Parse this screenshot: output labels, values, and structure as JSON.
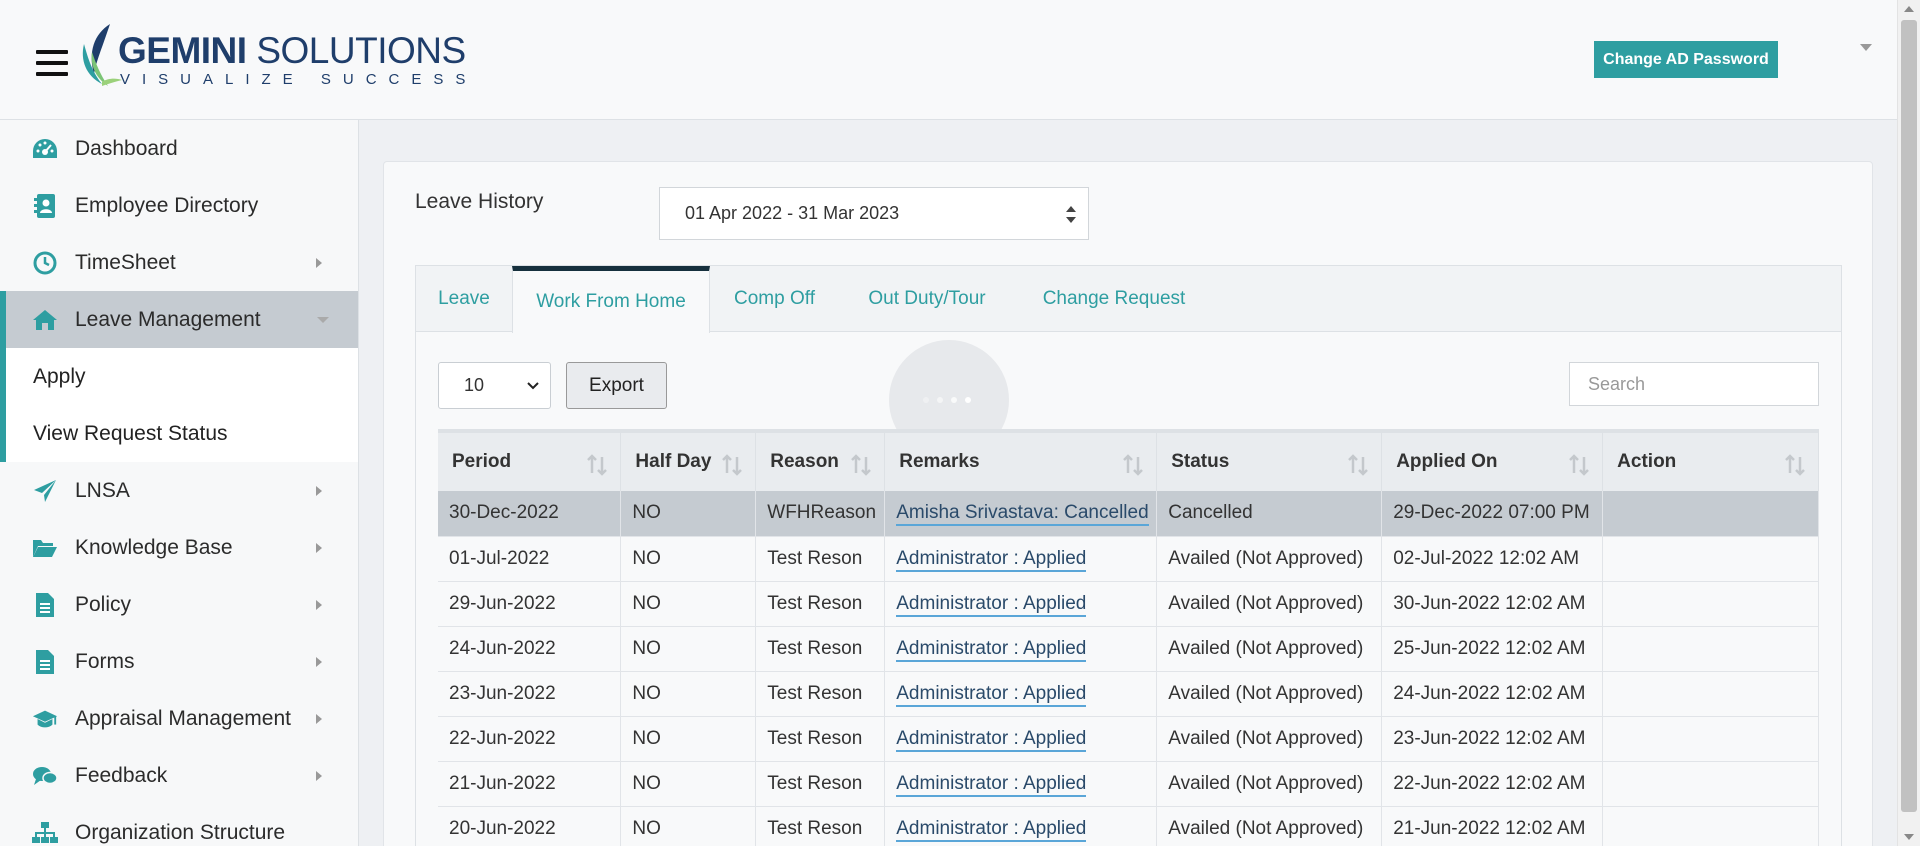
{
  "header": {
    "logo_name_bold": "GEMINI",
    "logo_name_rest": " SOLUTIONS",
    "logo_tagline": "VISUALIZE SUCCESS",
    "change_password_label": "Change AD Password"
  },
  "colors": {
    "accent": "#2e9ea1",
    "dark_tab": "#16303d",
    "link_underline": "#5aa6d8"
  },
  "sidebar": {
    "items": [
      {
        "label": "Dashboard",
        "icon": "dashboard-gauge-icon"
      },
      {
        "label": "Employee Directory",
        "icon": "contacts-book-icon"
      },
      {
        "label": "TimeSheet",
        "icon": "clock-icon"
      },
      {
        "label": "Leave Management",
        "icon": "home-icon"
      },
      {
        "label": "LNSA",
        "icon": "paper-plane-icon"
      },
      {
        "label": "Knowledge Base",
        "icon": "folder-open-icon"
      },
      {
        "label": "Policy",
        "icon": "document-icon"
      },
      {
        "label": "Forms",
        "icon": "document-icon"
      },
      {
        "label": "Appraisal Management",
        "icon": "graduation-cap-icon"
      },
      {
        "label": "Feedback",
        "icon": "chat-bubbles-icon"
      },
      {
        "label": "Organization Structure",
        "icon": "org-chart-icon"
      }
    ],
    "subitems": [
      {
        "label": "Apply"
      },
      {
        "label": "View Request Status"
      }
    ]
  },
  "main": {
    "title": "Leave History",
    "period": "01 Apr 2022 - 31 Mar 2023",
    "tabs": [
      {
        "label": "Leave"
      },
      {
        "label": "Work From Home"
      },
      {
        "label": "Comp Off"
      },
      {
        "label": "Out Duty/Tour"
      },
      {
        "label": "Change Request"
      }
    ],
    "page_length": "10",
    "export_label": "Export",
    "search_placeholder": "Search"
  },
  "table": {
    "columns": [
      "Period",
      "Half Day",
      "Reason",
      "Remarks",
      "Status",
      "Applied On",
      "Action"
    ],
    "rows": [
      [
        "30-Dec-2022",
        "NO",
        "WFHReason",
        "Amisha Srivastava: Cancelled",
        "Cancelled",
        "29-Dec-2022 07:00 PM",
        ""
      ],
      [
        "01-Jul-2022",
        "NO",
        "Test Reson",
        "Administrator : Applied",
        "Availed (Not Approved)",
        "02-Jul-2022 12:02 AM",
        ""
      ],
      [
        "29-Jun-2022",
        "NO",
        "Test Reson",
        "Administrator : Applied",
        "Availed (Not Approved)",
        "30-Jun-2022 12:02 AM",
        ""
      ],
      [
        "24-Jun-2022",
        "NO",
        "Test Reson",
        "Administrator : Applied",
        "Availed (Not Approved)",
        "25-Jun-2022 12:02 AM",
        ""
      ],
      [
        "23-Jun-2022",
        "NO",
        "Test Reson",
        "Administrator : Applied",
        "Availed (Not Approved)",
        "24-Jun-2022 12:02 AM",
        ""
      ],
      [
        "22-Jun-2022",
        "NO",
        "Test Reson",
        "Administrator : Applied",
        "Availed (Not Approved)",
        "23-Jun-2022 12:02 AM",
        ""
      ],
      [
        "21-Jun-2022",
        "NO",
        "Test Reson",
        "Administrator : Applied",
        "Availed (Not Approved)",
        "22-Jun-2022 12:02 AM",
        ""
      ],
      [
        "20-Jun-2022",
        "NO",
        "Test Reson",
        "Administrator : Applied",
        "Availed (Not Approved)",
        "21-Jun-2022 12:02 AM",
        ""
      ]
    ]
  }
}
